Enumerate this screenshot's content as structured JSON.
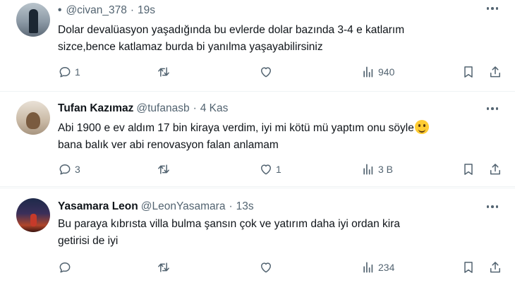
{
  "tweets": [
    {
      "name": "",
      "bullet": "•",
      "handle": "@civan_378",
      "time": "19s",
      "text": "Dolar devalüasyon yaşadığında bu evlerde dolar bazında 3-4 e katlarım\nsizce,bence katlamaz burda bi yanılma yaşayabilirsiniz",
      "replies": "1",
      "retweets": "",
      "likes": "",
      "views": "940"
    },
    {
      "name": "Tufan Kazımaz",
      "handle": "@tufanasb",
      "time": "4 Kas",
      "text": "Abi 1900 e ev aldım 17 bin kiraya verdim, iyi mi kötü mü yaptım onu söyle",
      "text2": "bana balık ver abi renovasyon falan anlamam",
      "replies": "3",
      "retweets": "",
      "likes": "1",
      "views": "3 B"
    },
    {
      "name": "Yasamara Leon",
      "handle": "@LeonYasamara",
      "time": "13s",
      "text": "Bu paraya kıbrısta villa bulma şansın çok ve yatırım daha iyi ordan kira\ngetirisi de iyi",
      "replies": "",
      "retweets": "",
      "likes": "",
      "views": "234"
    }
  ],
  "separator": "·",
  "icons": [
    "reply-icon",
    "retweet-icon",
    "like-icon",
    "views-icon",
    "bookmark-icon",
    "share-icon",
    "more-icon"
  ],
  "colors": {
    "text": "#0f1419",
    "secondary": "#536471",
    "divider": "#eff3f4"
  }
}
